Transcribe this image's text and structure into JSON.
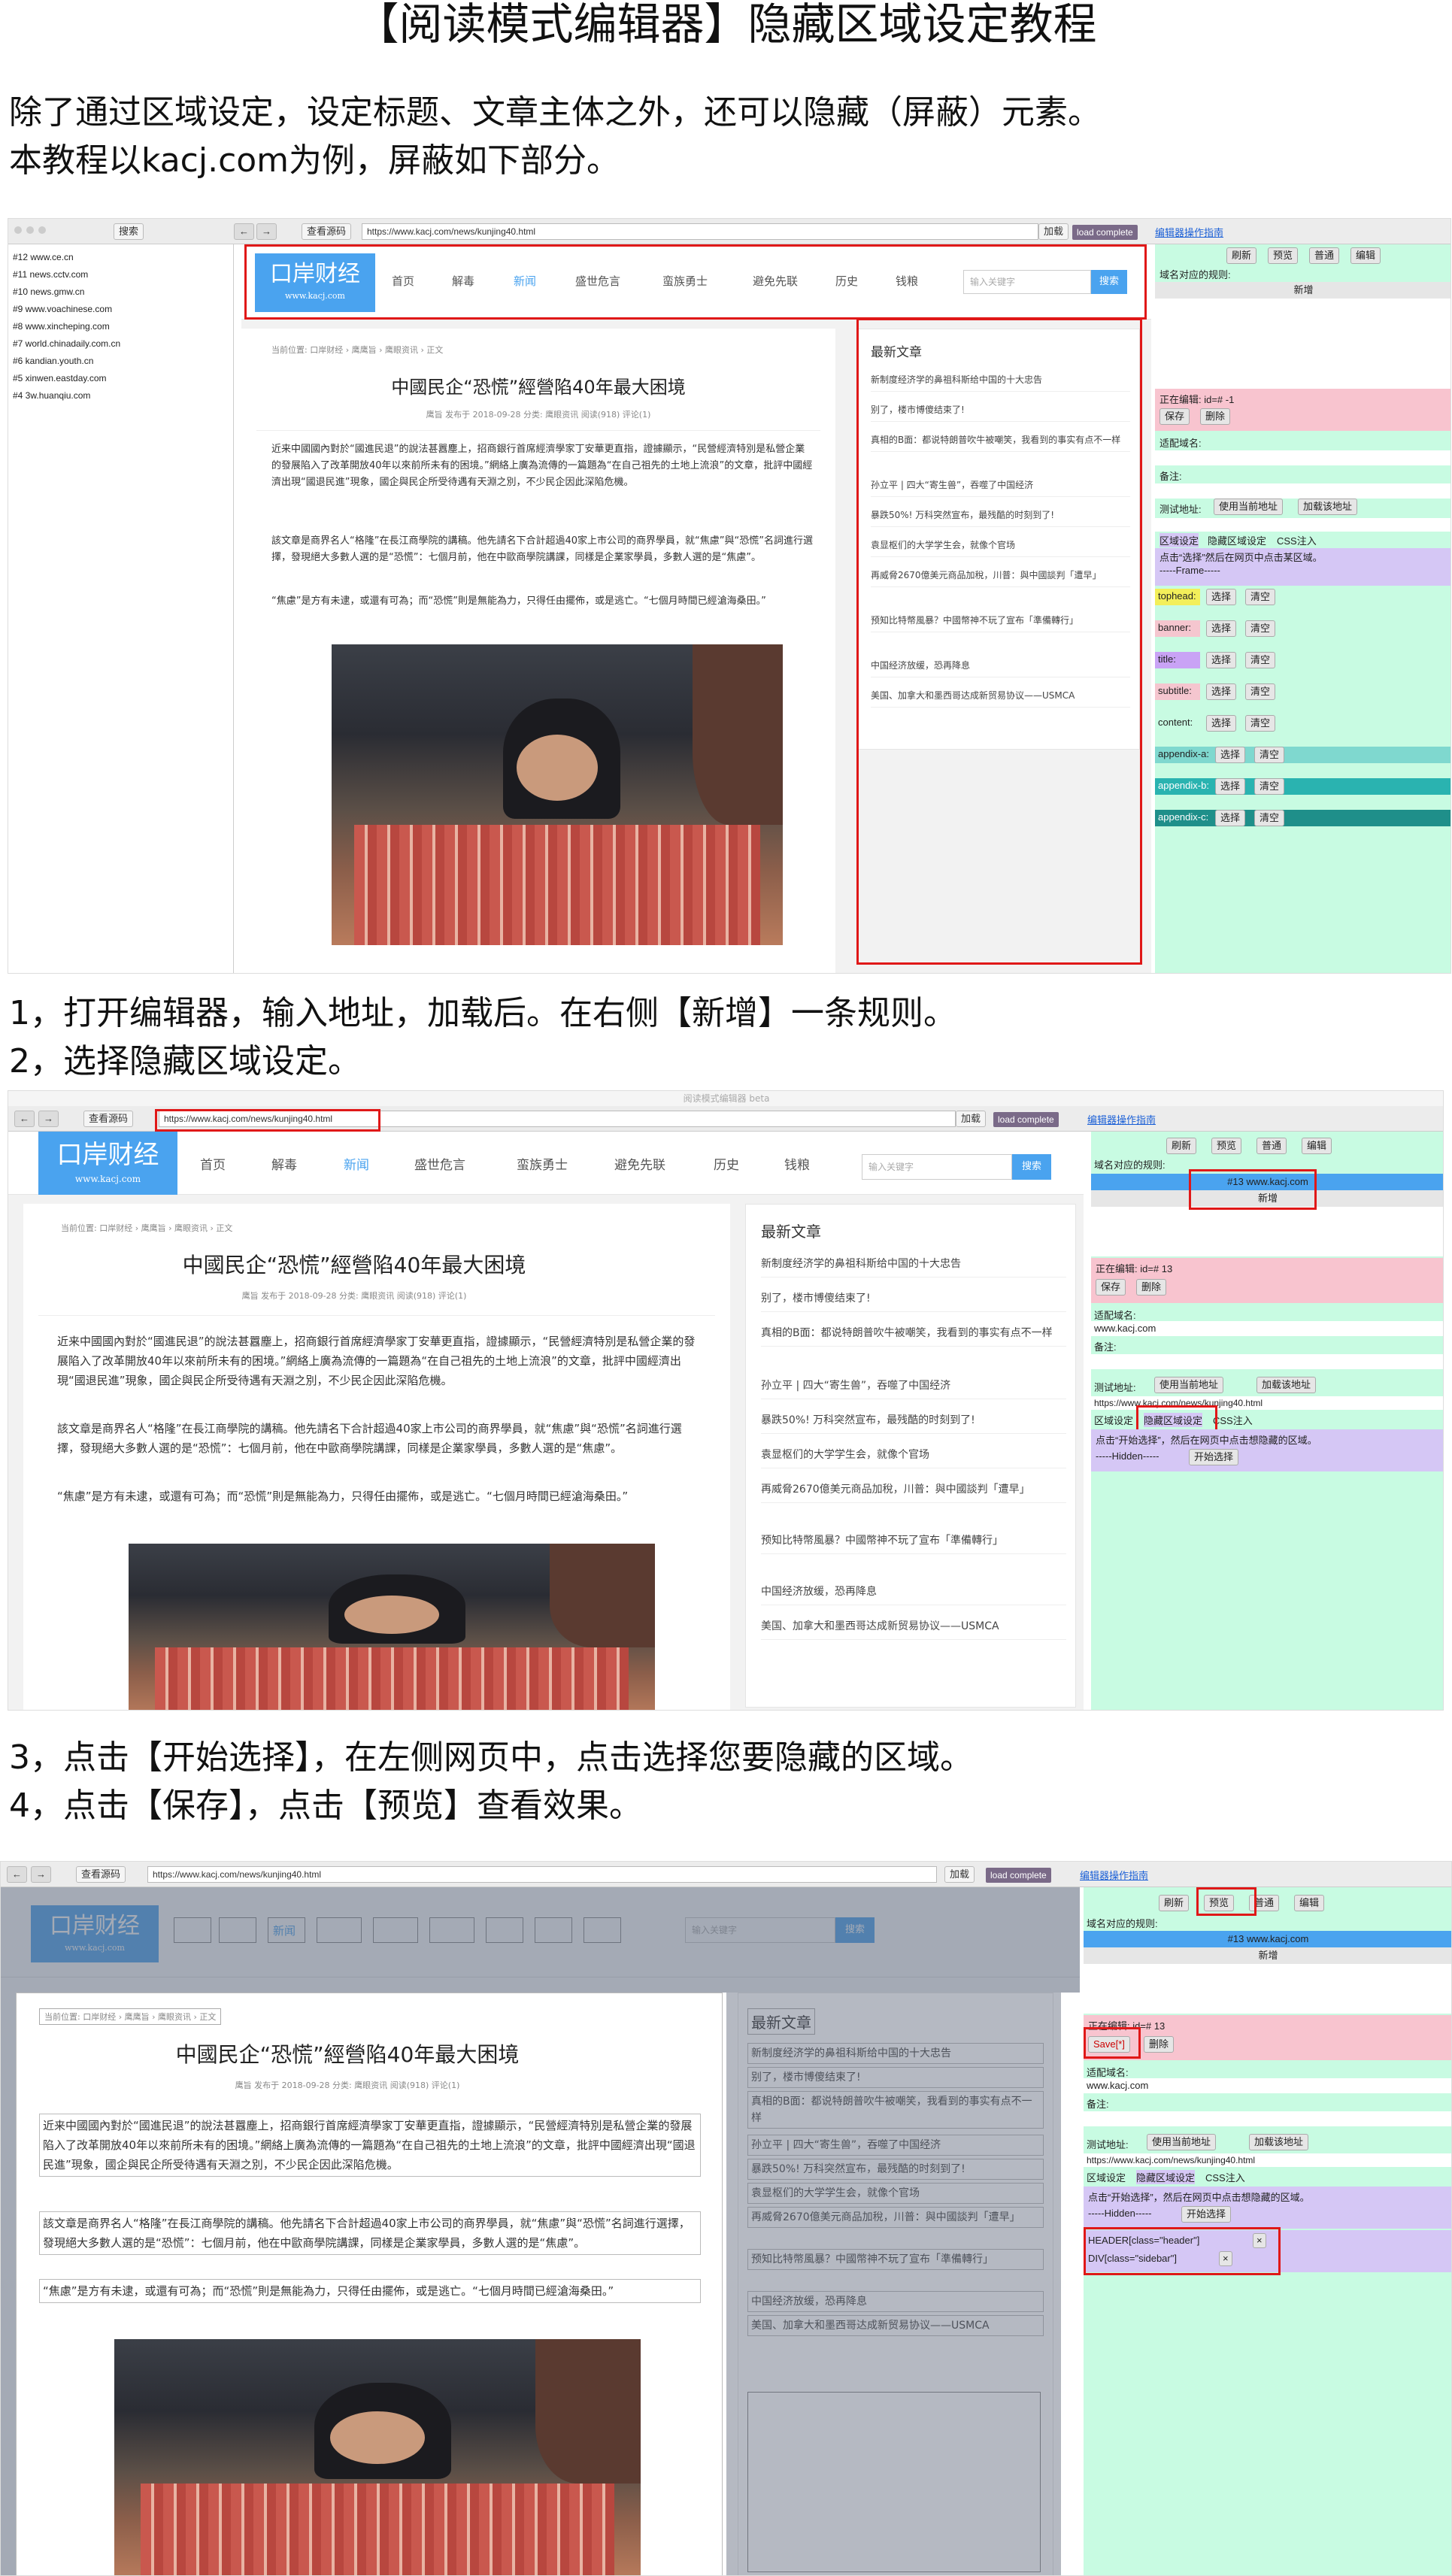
{
  "title": "【阅读模式编辑器】隐藏区域设定教程",
  "intro": [
    "除了通过区域设定，设定标题、文章主体之外，还可以隐藏（屏蔽）元素。",
    "本教程以kacj.com为例，屏蔽如下部分。"
  ],
  "steps": [
    "1，打开编辑器，输入地址，加载后。在右侧【新增】一条规则。",
    "2，选择隐藏区域设定。",
    "3，点击【开始选择】，在左侧网页中，点击选择您要隐藏的区域。",
    "4，点击【保存】，点击【预览】查看效果。"
  ],
  "window_title": "阅读模式编辑器 beta",
  "toolbar": {
    "search": "搜索",
    "view_source": "查看源码",
    "url": "https://www.kacj.com/news/kunjing40.html",
    "load": "加载",
    "status": "load complete",
    "guide": "编辑器操作指南"
  },
  "sites": [
    "#12 www.ce.cn",
    "#11 news.cctv.com",
    "#10 news.gmw.cn",
    "#9 www.voachinese.com",
    "#8 www.xincheping.com",
    "#7 world.chinadaily.com.cn",
    "#6 kandian.youth.cn",
    "#5 xinwen.eastday.com",
    "#4 3w.huanqiu.com"
  ],
  "site_page": {
    "logo": "口岸财经",
    "logo_sub": "www.kacj.com",
    "nav": [
      "首页",
      "解毒",
      "新闻",
      "盛世危言",
      "蛮族勇士",
      "避免先联",
      "历史",
      "钱粮"
    ],
    "search_placeholder": "输入关键字",
    "search_btn": "搜索",
    "breadcrumb": "当前位置:  口岸财经 › 鹰鹰旨  ›  鹰眼资讯  ›  正文",
    "article_title": "中國民企“恐慌”經營陷40年最大困境",
    "meta": "鹰旨 发布于 2018-09-28    分类: 鹰眼资讯    阅读(918)    评论(1)",
    "paras": [
      "近来中國國內對於“國進民退”的說法甚囂塵上，招商銀行首席經濟學家丁安華更直指，證據顯示，“民營經濟特別是私營企業的發展陷入了改革開放40年以來前所未有的困境。”網絡上廣為流傳的一篇題為“在自己祖先的土地上流浪”的文章，批評中國經濟出現“國退民進”現象，國企與民企所受待遇有天淵之別，不少民企因此深陷危機。",
      "該文章是商界名人“格隆”在長江商學院的講稿。他先請名下合計超過40家上市公司的商界學員，就“焦慮”與“恐慌”名詞進行選擇，發現絕大多數人選的是“恐慌”：七個月前，他在中歐商學院講課，同樣是企業家學員，多數人選的是“焦慮”。",
      "“焦慮”是方有未逮，或還有可為；而“恐慌”則是無能為力，只得任由擺佈，或是逃亡。“七個月時間已經滄海桑田。”"
    ],
    "sidebar_title": "最新文章",
    "sidebar_items": [
      "新制度经济学的鼻祖科斯给中国的十大忠告",
      "别了，楼市博傻结束了!",
      "真相的B面：都说特朗普吹牛被嘲笑，我看到的事实有点不一样",
      "孙立平 | 四大“寄生兽”，吞噬了中国经济",
      "暴跌50%! 万科突然宣布，最残酷的时刻到了!",
      "袁显枢们的大学学生会，就像个官场",
      "再威脅2670億美元商品加稅，川普：與中國談判「遭早」",
      "预知比特幣風暴？中國幣神不玩了宣布「準備轉行」",
      "中国经济放缓，恐再降息",
      "美国、加拿大和墨西哥达成新贸易协议——USMCA"
    ]
  },
  "panel": {
    "refresh": "刷新",
    "preview": "预览",
    "normal": "普通",
    "edit": "编辑",
    "rules_label": "域名对应的规则:",
    "rule_item": "#13 www.kacj.com",
    "add": "新增",
    "editing_1": "正在编辑: id=# -1",
    "editing_2": "正在编辑: id=# 13",
    "save": "保存",
    "save_star": "Save[*]",
    "delete": "删除",
    "match_name": "适配域名:",
    "match_value": "www.kacj.com",
    "remark": "备注:",
    "test_url": "测试地址:",
    "use_current": "使用当前地址",
    "load_this": "加载该地址",
    "test_url_value": "https://www.kacj.com/news/kunjing40.html",
    "area_set": "区域设定",
    "hide_area": "隐藏区域设定",
    "css_inject": "CSS注入",
    "select_hint": "点击“选择”然后在网页中点击某区域。",
    "frame": "-----Frame-----",
    "start_hint": "点击“开始选择”，然后在网页中点击想隐藏的区域。",
    "hidden": "-----Hidden-----",
    "start_select": "开始选择",
    "select": "选择",
    "clear": "清空",
    "slots": [
      "tophead:",
      "banner:",
      "title:",
      "subtitle:",
      "content:",
      "appendix-a:",
      "appendix-b:",
      "appendix-c:"
    ],
    "slot_colors": [
      "#f3ef5a",
      "#f5c6cf",
      "#c9a3f5",
      "#f5c6cf",
      "#c8fbe2",
      "#7fd8cf",
      "#2ab3b0",
      "#1f8f8a"
    ],
    "hidden_items": [
      "HEADER[class=\"header\"]",
      "DIV[class=\"sidebar\"]"
    ]
  },
  "colors": {
    "accent": "#4aa3ef",
    "highlight": "#e01818",
    "panel": "#c8fbe2"
  }
}
